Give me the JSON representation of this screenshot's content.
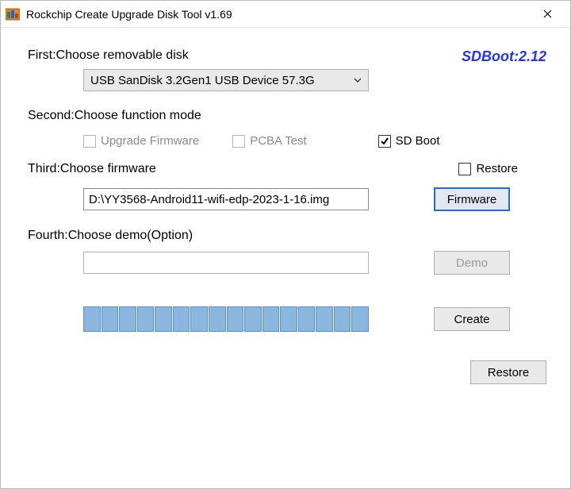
{
  "window": {
    "title": "Rockchip Create Upgrade Disk Tool v1.69"
  },
  "sdboot_label": "SDBoot:2.12",
  "step1": {
    "label": "First:Choose removable disk",
    "disk_selected": "USB  SanDisk 3.2Gen1 USB Device   57.3G"
  },
  "step2": {
    "label": "Second:Choose function mode",
    "upgrade_firmware_label": "Upgrade Firmware",
    "pcba_test_label": "PCBA Test",
    "sd_boot_label": "SD Boot",
    "restore_label": "Restore",
    "upgrade_firmware_checked": false,
    "pcba_test_checked": false,
    "sd_boot_checked": true,
    "restore_checked": false
  },
  "step3": {
    "label": "Third:Choose firmware",
    "path": "D:\\YY3568-Android11-wifi-edp-2023-1-16.img",
    "button": "Firmware"
  },
  "step4": {
    "label": "Fourth:Choose demo(Option)",
    "path": "",
    "button": "Demo"
  },
  "actions": {
    "create": "Create",
    "restore": "Restore"
  },
  "progress": {
    "segments": 16
  }
}
